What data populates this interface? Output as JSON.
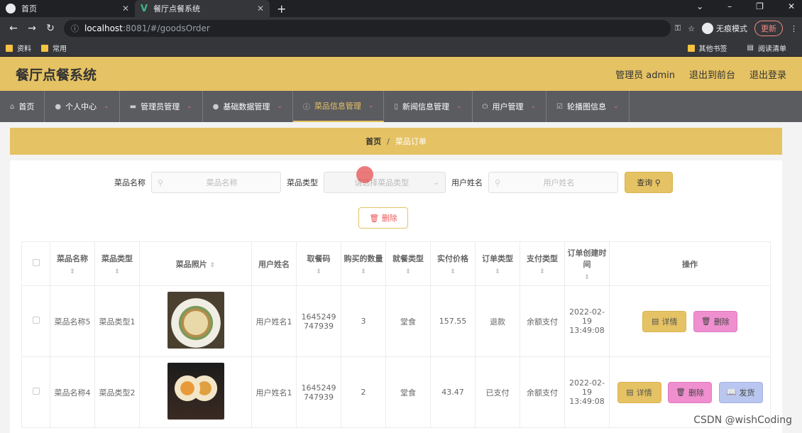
{
  "browser": {
    "tabs": [
      {
        "title": "首页",
        "icon": "globe-icon"
      },
      {
        "title": "餐厅点餐系统",
        "icon": "vue-logo-icon"
      }
    ],
    "url_host": "localhost",
    "url_path": ":8081/#/goodsOrder",
    "incognito_label": "无痕模式",
    "update_label": "更新",
    "bookmarks_left": [
      "资料",
      "常用"
    ],
    "bookmarks_right": [
      "其他书签",
      "阅读清单"
    ]
  },
  "header": {
    "title": "餐厅点餐系统",
    "user": "管理员 admin",
    "back_front": "退出到前台",
    "logout": "退出登录"
  },
  "nav": [
    {
      "label": "首页",
      "icon": "home-icon",
      "has_dropdown": false
    },
    {
      "label": "个人中心",
      "icon": "user-icon",
      "has_dropdown": true
    },
    {
      "label": "管理员管理",
      "icon": "briefcase-icon",
      "has_dropdown": true
    },
    {
      "label": "基础数据管理",
      "icon": "user-icon",
      "has_dropdown": true
    },
    {
      "label": "菜品信息管理",
      "icon": "info-icon",
      "has_dropdown": true,
      "active": true
    },
    {
      "label": "新闻信息管理",
      "icon": "phone-icon",
      "has_dropdown": true
    },
    {
      "label": "用户管理",
      "icon": "power-icon",
      "has_dropdown": true
    },
    {
      "label": "轮播图信息",
      "icon": "checkbox-icon",
      "has_dropdown": true
    }
  ],
  "breadcrumb": {
    "home": "首页",
    "separator": "/",
    "current": "菜品订单"
  },
  "search": {
    "dish_name_label": "菜品名称",
    "dish_name_placeholder": "菜品名称",
    "dish_type_label": "菜品类型",
    "dish_type_placeholder": "请选择菜品类型",
    "user_name_label": "用户姓名",
    "user_name_placeholder": "用户姓名",
    "query_label": "查询"
  },
  "delete_label": "删除",
  "table": {
    "headers": [
      "菜品名称",
      "菜品类型",
      "菜品照片",
      "用户姓名",
      "取餐码",
      "购买的数量",
      "就餐类型",
      "实付价格",
      "订单类型",
      "支付类型",
      "订单创建时间",
      "操作"
    ],
    "rows": [
      {
        "name": "菜品名称5",
        "type": "菜品类型1",
        "user": "用户姓名1",
        "code": "1645249747939",
        "qty": "3",
        "dine": "堂食",
        "price": "157.55",
        "order_type": "退款",
        "pay": "余额支付",
        "created": "2022-02-19 13:49:08",
        "actions": [
          "详情",
          "删除"
        ]
      },
      {
        "name": "菜品名称4",
        "type": "菜品类型2",
        "user": "用户姓名1",
        "code": "1645249747939",
        "qty": "2",
        "dine": "堂食",
        "price": "43.47",
        "order_type": "已支付",
        "pay": "余额支付",
        "created": "2022-02-19 13:49:08",
        "actions": [
          "详情",
          "删除",
          "发货"
        ]
      }
    ]
  },
  "watermark": "CSDN @wishCoding",
  "colors": {
    "accent": "#e5c263",
    "nav_bg": "#5b5c60",
    "delete_pink": "#f08fcf",
    "ship_blue": "#b9c6ef"
  }
}
